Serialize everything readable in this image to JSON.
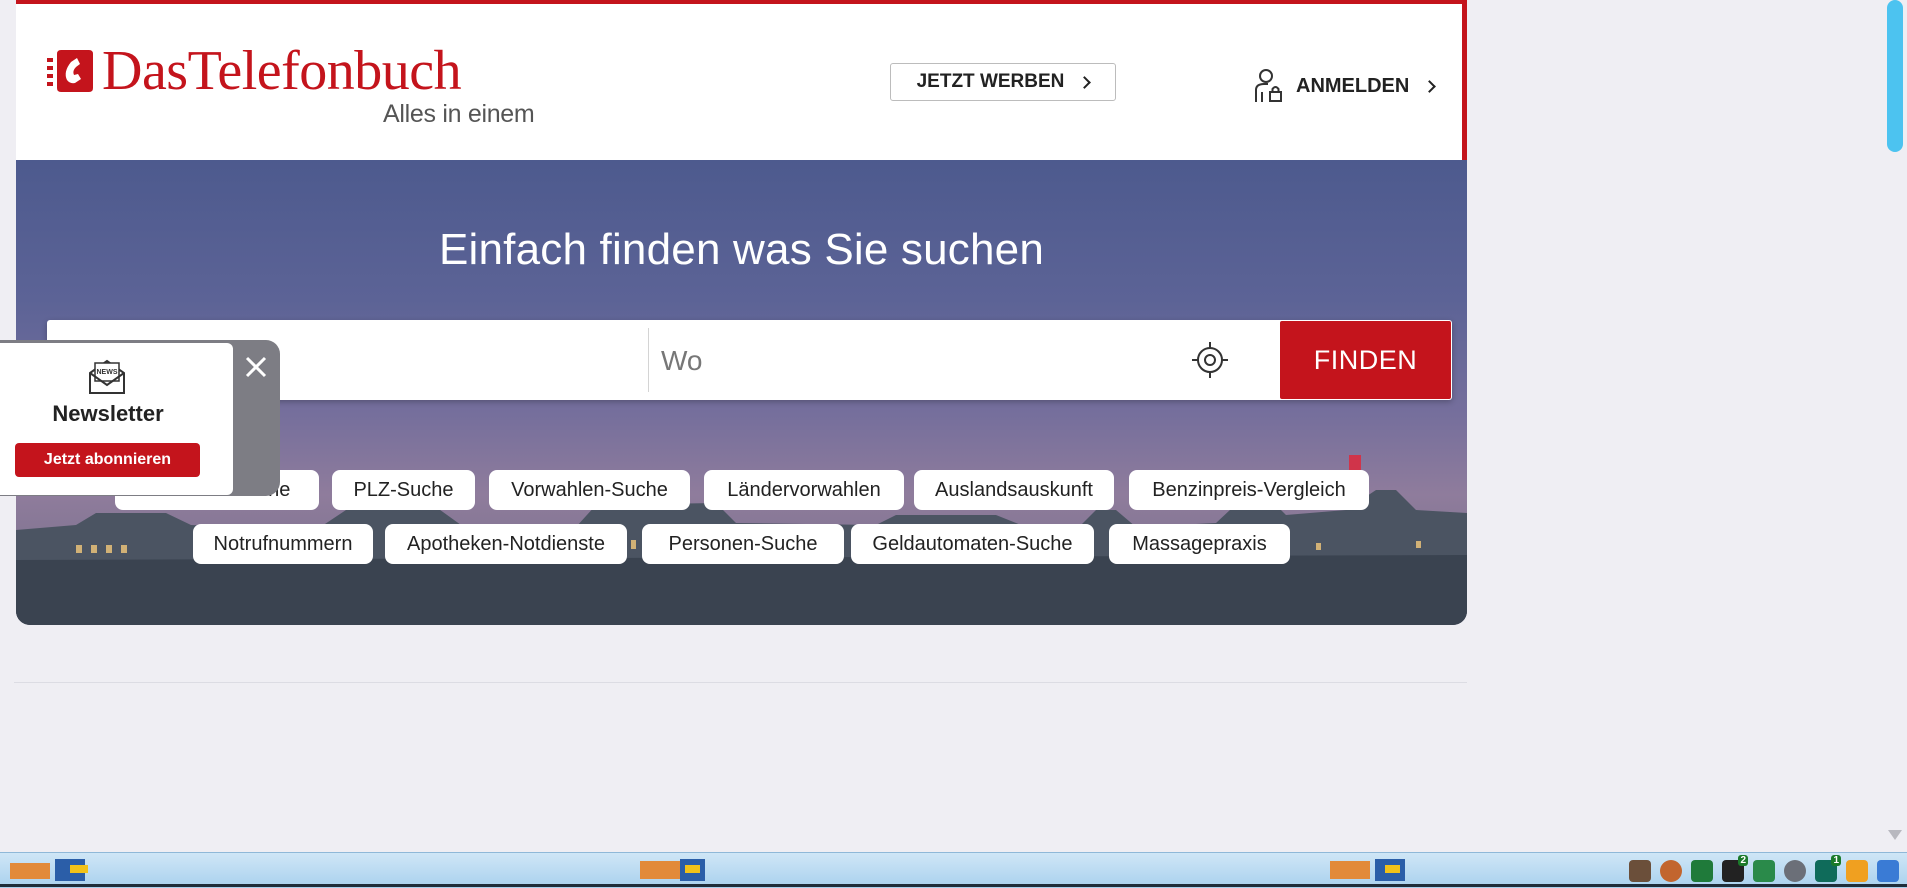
{
  "header": {
    "logo_title": "DasTelefonbuch",
    "logo_subtitle": "Alles in einem",
    "advertise_label": "JETZT WERBEN",
    "login_label": "ANMELDEN"
  },
  "hero": {
    "title": "Einfach finden was Sie suchen",
    "search": {
      "was_placeholder": "",
      "wo_placeholder": "Wo",
      "submit_label": "FINDEN"
    },
    "chips_row1": [
      "Rückwärtssuche",
      "PLZ-Suche",
      "Vorwahlen-Suche",
      "Ländervorwahlen",
      "Auslandsauskunft",
      "Benzinpreis-Vergleich"
    ],
    "chips_row2": [
      "Notrufnummern",
      "Apotheken-Notdienste",
      "Personen-Suche",
      "Geldautomaten-Suche",
      "Massagepraxis"
    ]
  },
  "newsletter": {
    "icon_label": "NEWS",
    "title": "Newsletter",
    "button_label": "Jetzt abonnieren"
  },
  "taskbar": {
    "tray_badges": [
      "2",
      "1"
    ]
  },
  "colors": {
    "brand_red": "#c4141c",
    "scroll_accent": "#4cc3f0"
  }
}
